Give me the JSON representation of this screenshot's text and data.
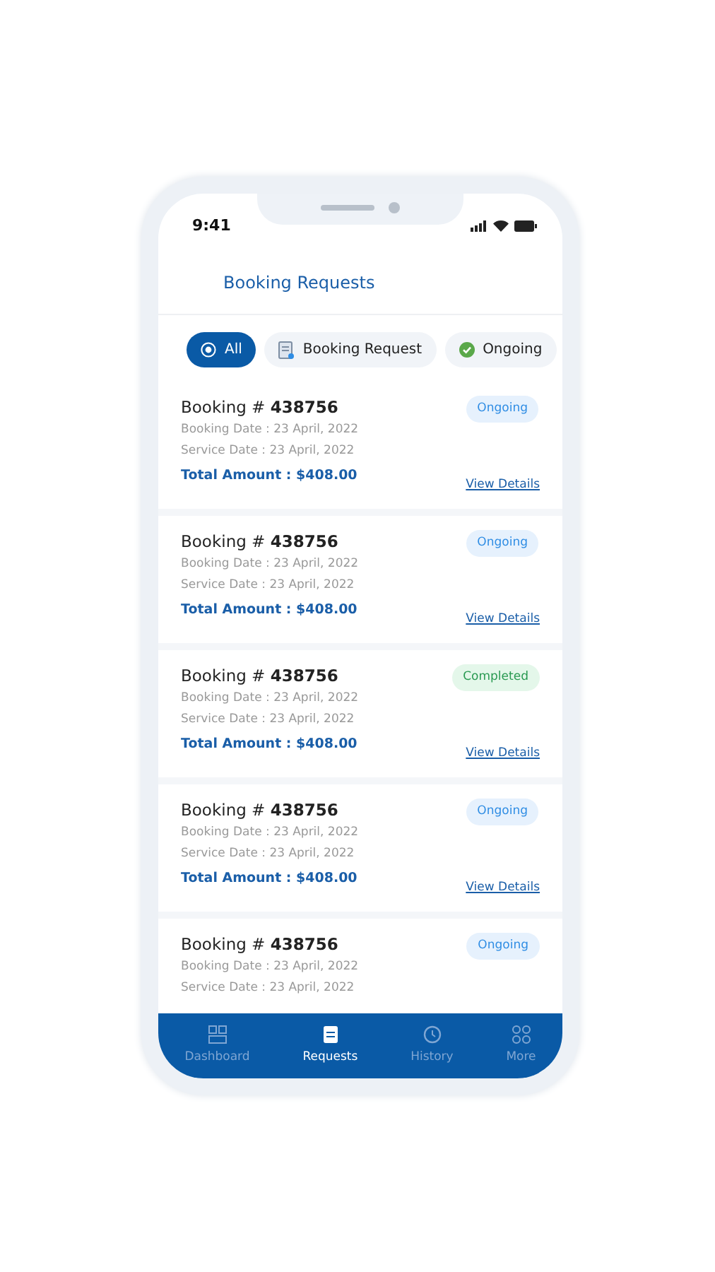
{
  "status_bar": {
    "time": "9:41"
  },
  "header": {
    "title": "Booking Requests"
  },
  "filters": [
    {
      "label": "All",
      "selected": true
    },
    {
      "label": "Booking Request",
      "selected": false
    },
    {
      "label": "Ongoing",
      "selected": false
    }
  ],
  "bookings": [
    {
      "title": "Booking # **438756**",
      "booking_date": "Booking Date : 23 April, 2022",
      "service_date": "Service Date : 23 April, 2022",
      "total": "Total Amount : $408.00",
      "link": "View Details",
      "status": {
        "kind": "ongoing",
        "label": "Ongoing"
      }
    },
    {
      "title": "Booking # **438756**",
      "booking_date": "Booking Date : 23 April, 2022",
      "service_date": "Service Date : 23 April, 2022",
      "total": "Total Amount : $408.00",
      "link": "View Details",
      "status": {
        "kind": "ongoing",
        "label": "Ongoing"
      }
    },
    {
      "title": "Booking # **438756**",
      "booking_date": "Booking Date : 23 April, 2022",
      "service_date": "Service Date : 23 April, 2022",
      "total": "Total Amount : $408.00",
      "link": "View Details",
      "status": {
        "kind": "completed",
        "label": "Completed"
      }
    },
    {
      "title": "Booking # **438756**",
      "booking_date": "Booking Date : 23 April, 2022",
      "service_date": "Service Date : 23 April, 2022",
      "total": "Total Amount : $408.00",
      "link": "View Details",
      "status": {
        "kind": "ongoing",
        "label": "Ongoing"
      }
    },
    {
      "title": "Booking # **438756**",
      "booking_date": "Booking Date : 23 April, 2022",
      "service_date": "Service Date : 23 April, 2022",
      "status": {
        "kind": "ongoing",
        "label": "Ongoing"
      }
    }
  ],
  "bottom_nav": [
    {
      "label": "Dashboard",
      "selected": false
    },
    {
      "label": "Requests",
      "selected": true
    },
    {
      "label": "History",
      "selected": false
    },
    {
      "label": "More",
      "selected": false
    }
  ]
}
